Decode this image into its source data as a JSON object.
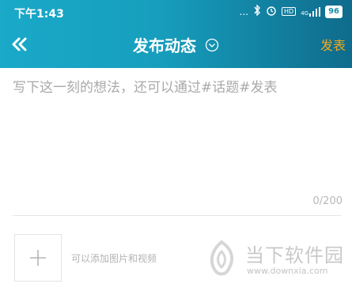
{
  "status": {
    "time": "下午1:43",
    "dots": "...",
    "signal_label": "4G",
    "hd": "HD",
    "battery": "96"
  },
  "nav": {
    "title": "发布动态",
    "publish_label": "发表"
  },
  "editor": {
    "placeholder": "写下这一刻的想法，还可以通过#话题#发表",
    "counter": "0/200"
  },
  "media": {
    "hint": "可以添加图片和视频"
  },
  "watermark": {
    "title": "当下软件园",
    "url": "www.downxia.com"
  },
  "colors": {
    "header_start": "#1aa9c9",
    "header_end": "#0f6b8c",
    "accent": "#f2a91b"
  }
}
